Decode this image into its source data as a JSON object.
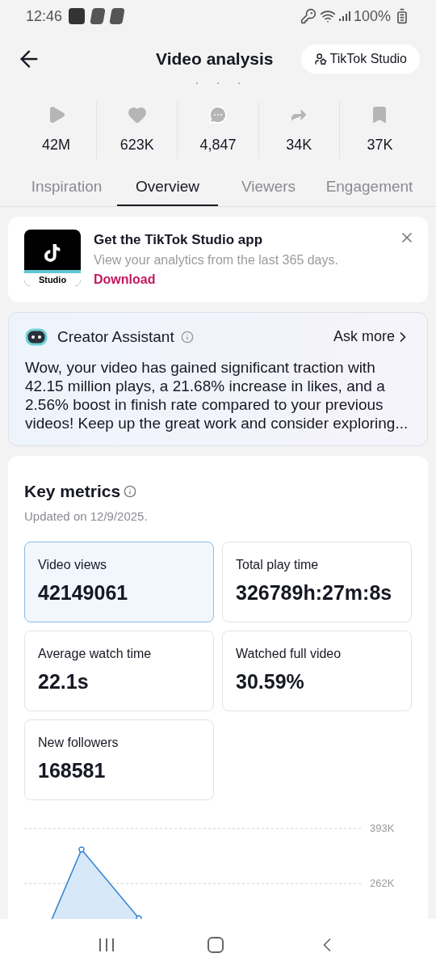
{
  "status_bar": {
    "time": "12:46",
    "battery": "100%"
  },
  "header": {
    "title": "Video analysis",
    "studio_button": "TikTok Studio"
  },
  "stats": [
    {
      "kind": "play",
      "value": "42M"
    },
    {
      "kind": "like",
      "value": "623K"
    },
    {
      "kind": "comment",
      "value": "4,847"
    },
    {
      "kind": "share",
      "value": "34K"
    },
    {
      "kind": "save",
      "value": "37K"
    }
  ],
  "tabs": [
    {
      "label": "Inspiration",
      "selected": false
    },
    {
      "label": "Overview",
      "selected": true
    },
    {
      "label": "Viewers",
      "selected": false
    },
    {
      "label": "Engagement",
      "selected": false
    }
  ],
  "promo": {
    "app_label": "Studio",
    "title": "Get the TikTok Studio app",
    "subtitle": "View your analytics from the last 365 days.",
    "link": "Download"
  },
  "assistant": {
    "title": "Creator Assistant",
    "action": "Ask more",
    "text": "Wow, your video has gained significant traction with 42.15 million plays, a 21.68% increase in likes, and a 2.56% boost in finish rate compared to your previous videos! Keep up the great work and consider exploring..."
  },
  "key_metrics": {
    "title": "Key metrics",
    "updated": "Updated on 12/9/2025.",
    "metrics": [
      {
        "label": "Video views",
        "value": "42149061",
        "selected": true
      },
      {
        "label": "Total play time",
        "value": "326789h:27m:8s",
        "selected": false
      },
      {
        "label": "Average watch time",
        "value": "22.1s",
        "selected": false
      },
      {
        "label": "Watched full video",
        "value": "30.59%",
        "selected": false
      },
      {
        "label": "New followers",
        "value": "168581",
        "selected": false
      }
    ],
    "chart": {
      "axis_labels": [
        "393K",
        "262K"
      ]
    }
  }
}
